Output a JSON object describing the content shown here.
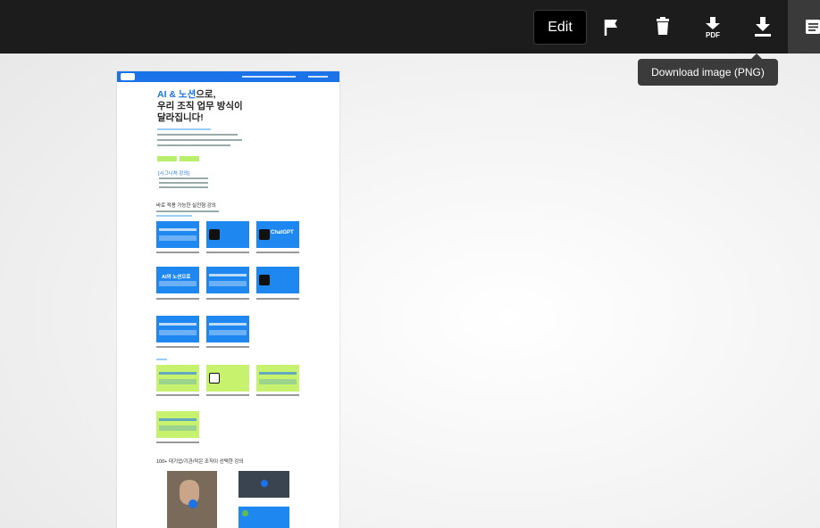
{
  "toolbar": {
    "edit_label": "Edit",
    "icons": [
      "flag-icon",
      "trash-icon",
      "download-pdf-icon",
      "download-image-icon",
      "document-icon"
    ],
    "pdf_label": "PDF",
    "tooltip": "Download image (PNG)"
  },
  "preview": {
    "headline_blue": "AI & 노션",
    "headline_rest1": "으로,",
    "headline_line2": "우리 조직 업무 방식이",
    "headline_line3": "달라집니다!",
    "section_course_tag": "[시그니처 강의]",
    "section_practical": "바로 적용 가능한 실전형 강의",
    "section_partners": "100+ 대기업/기관/작은 조직이 선택한 강의",
    "card_chatgpt": "ChatGPT",
    "card_ai_notion": "AI와 노션으로"
  },
  "colors": {
    "topbar": "#1c1c1c",
    "accent_blue": "#1a73e8",
    "lime": "#c6f26d"
  }
}
